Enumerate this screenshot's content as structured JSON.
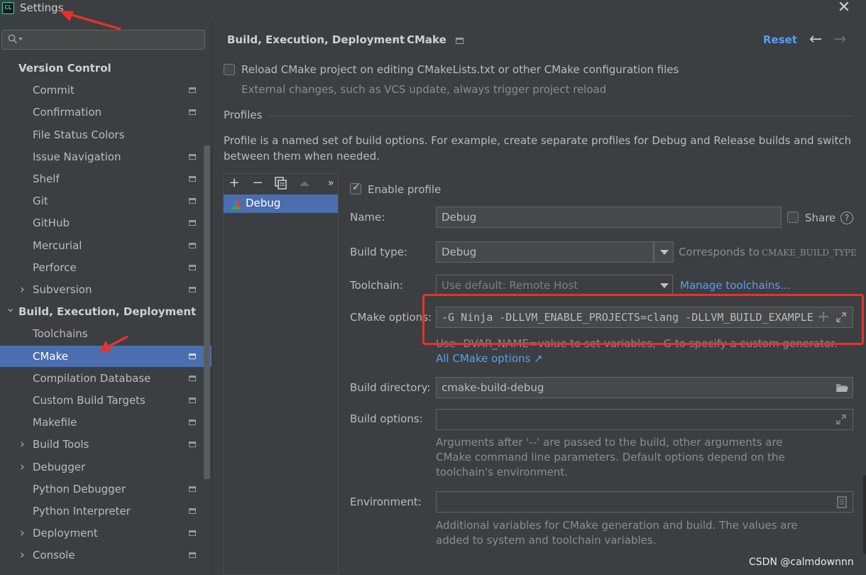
{
  "window": {
    "title": "Settings",
    "close_glyph": "✕",
    "app_icon": "CL"
  },
  "search": {
    "placeholder": ""
  },
  "sidebar": {
    "items": [
      {
        "label": "Version Control",
        "type": "head"
      },
      {
        "label": "Commit",
        "pin": true
      },
      {
        "label": "Confirmation",
        "pin": true
      },
      {
        "label": "File Status Colors",
        "pin": false
      },
      {
        "label": "Issue Navigation",
        "pin": true
      },
      {
        "label": "Shelf",
        "pin": true
      },
      {
        "label": "Git",
        "pin": true
      },
      {
        "label": "GitHub",
        "pin": true
      },
      {
        "label": "Mercurial",
        "pin": true
      },
      {
        "label": "Perforce",
        "pin": true
      },
      {
        "label": "Subversion",
        "pin": true,
        "expandable": true
      },
      {
        "label": "Build, Execution, Deployment",
        "type": "head",
        "expanded": true
      },
      {
        "label": "Toolchains",
        "pin": false
      },
      {
        "label": "CMake",
        "pin": true,
        "selected": true
      },
      {
        "label": "Compilation Database",
        "pin": true
      },
      {
        "label": "Custom Build Targets",
        "pin": true
      },
      {
        "label": "Makefile",
        "pin": true
      },
      {
        "label": "Build Tools",
        "pin": true,
        "expandable": true
      },
      {
        "label": "Debugger",
        "pin": false,
        "expandable": true
      },
      {
        "label": "Python Debugger",
        "pin": true
      },
      {
        "label": "Python Interpreter",
        "pin": true
      },
      {
        "label": "Deployment",
        "pin": true,
        "expandable": true
      },
      {
        "label": "Console",
        "pin": true,
        "expandable": true
      }
    ]
  },
  "breadcrumb": {
    "parent": "Build, Execution, Deployment",
    "separator": "›",
    "current": "CMake"
  },
  "header": {
    "reset_label": "Reset",
    "back_glyph": "←",
    "forward_glyph": "→"
  },
  "reload": {
    "label": "Reload CMake project on editing CMakeLists.txt or other CMake configuration files",
    "hint": "External changes, such as VCS update, always trigger project reload",
    "checked": false
  },
  "profiles": {
    "section_title": "Profiles",
    "description_line1": "Profile is a named set of build options. For example, create separate profiles for Debug and Release builds and switch",
    "description_line2": "between them when needed.",
    "toolbar": {
      "add": "+",
      "remove": "−",
      "more": "»"
    },
    "list": [
      "Debug"
    ]
  },
  "form": {
    "enable_profile_label": "Enable profile",
    "enable_profile_checked": true,
    "name_label": "Name:",
    "name_value": "Debug",
    "share_label": "Share",
    "share_checked": false,
    "help_glyph": "?",
    "build_type_label": "Build type:",
    "build_type_value": "Debug",
    "build_type_note": "Corresponds to",
    "build_type_var": "CMAKE_BUILD_TYPE",
    "toolchain_label": "Toolchain:",
    "toolchain_value": "Use default: Remote Host",
    "manage_toolchains_link": "Manage toolchains...",
    "cmake_options_label": "CMake options:",
    "cmake_options_value": "-G Ninja -DLLVM_ENABLE_PROJECTS=clang -DLLVM_BUILD_EXAMPLE",
    "cmake_hint": "Use -DVAR_NAME=value to set variables, -G to specify a custom generator.",
    "all_cmake_options_link": "All CMake options ↗",
    "build_directory_label": "Build directory:",
    "build_directory_value": "cmake-build-debug",
    "build_options_label": "Build options:",
    "build_options_value": "",
    "build_options_hint_1": "Arguments after '--' are passed to the build, other arguments are",
    "build_options_hint_2": "CMake command line parameters. Default options depend on the",
    "build_options_hint_3": "toolchain's environment.",
    "environment_label": "Environment:",
    "environment_value": "",
    "environment_hint_1": "Additional variables for CMake generation and build. The values are",
    "environment_hint_2": "added to system and toolchain variables."
  },
  "watermark": "CSDN @calmdownnn",
  "colors": {
    "accent": "#4b6eaf",
    "link": "#589df6",
    "annotation": "#e8312c",
    "background": "#3c3f41"
  }
}
